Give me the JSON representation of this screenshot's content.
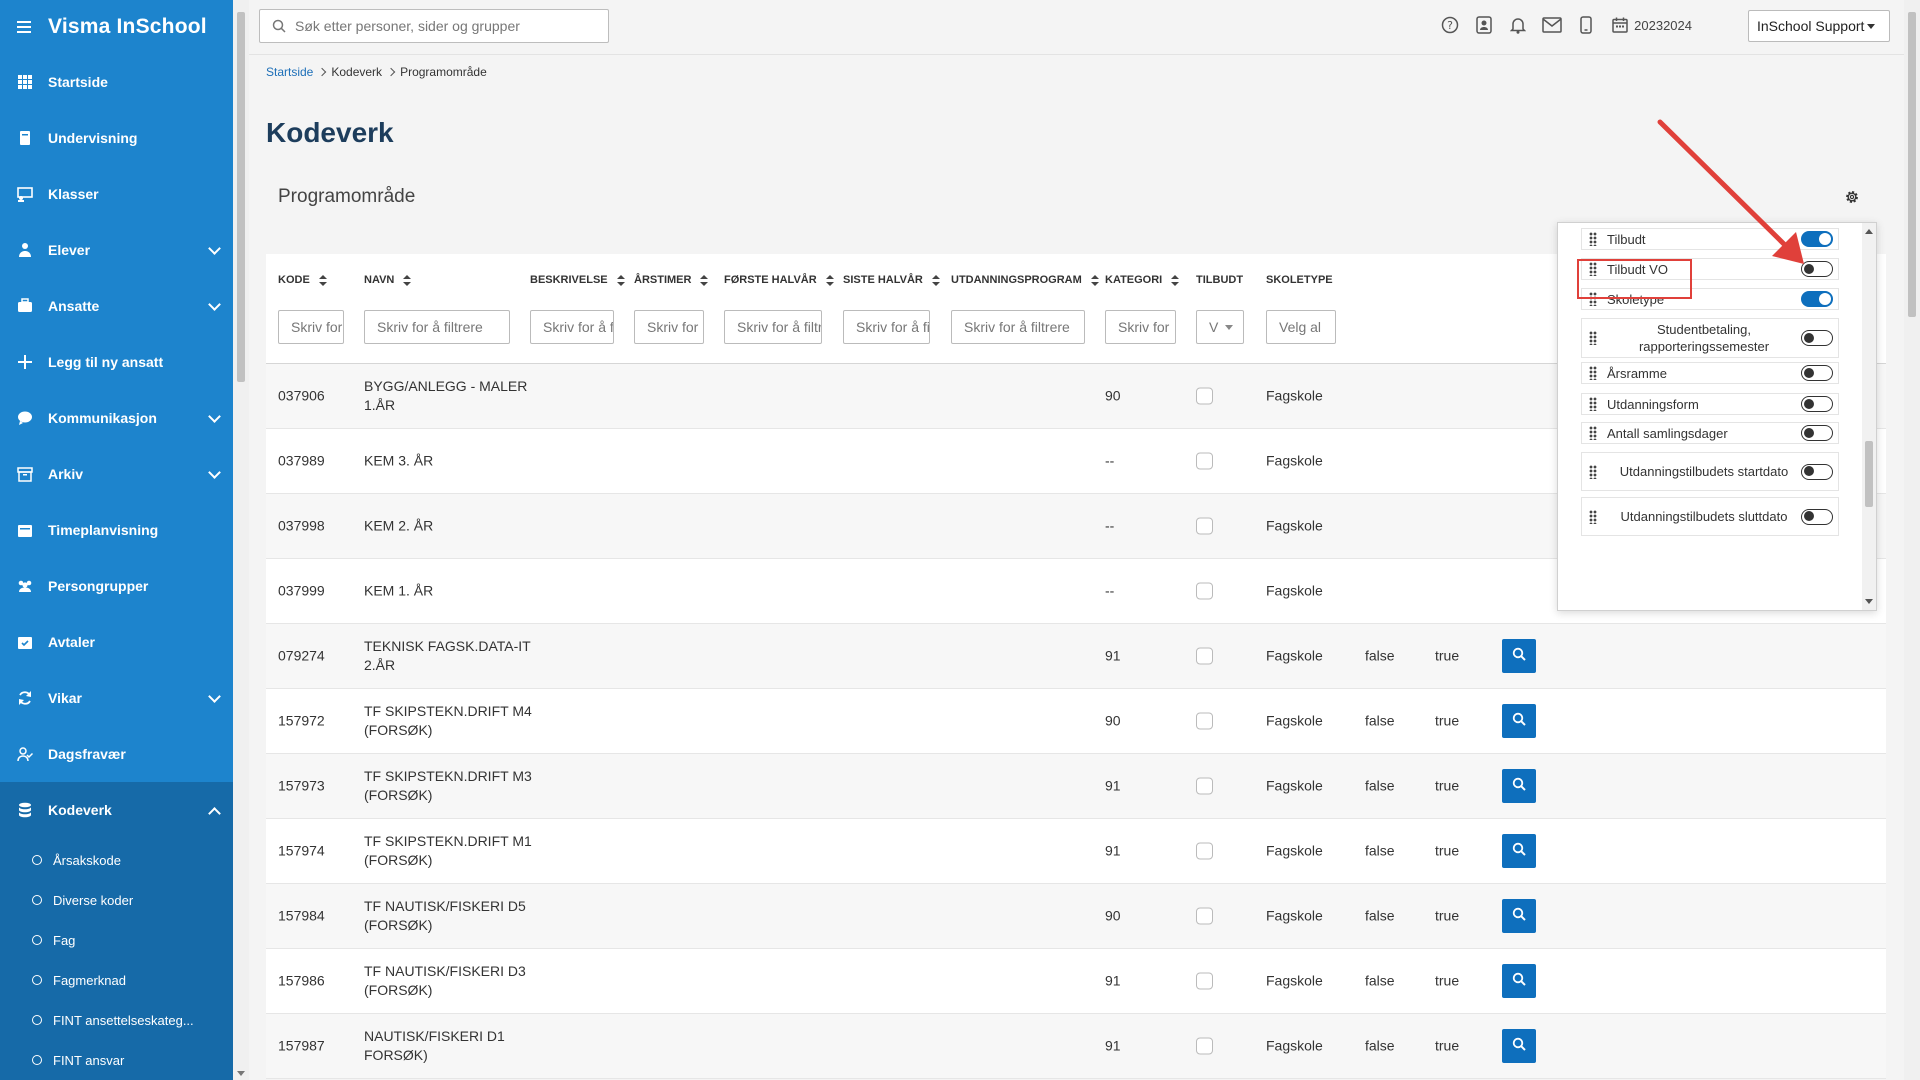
{
  "app": {
    "title": "Visma InSchool"
  },
  "sidebar": {
    "items": [
      {
        "label": "Startside",
        "icon": "grid-icon",
        "expandable": false
      },
      {
        "label": "Undervisning",
        "icon": "book-icon",
        "expandable": false
      },
      {
        "label": "Klasser",
        "icon": "classroom-icon",
        "expandable": false
      },
      {
        "label": "Elever",
        "icon": "student-icon",
        "expandable": true
      },
      {
        "label": "Ansatte",
        "icon": "briefcase-icon",
        "expandable": true
      },
      {
        "label": "Legg til ny ansatt",
        "icon": "plus-icon",
        "expandable": false
      },
      {
        "label": "Kommunikasjon",
        "icon": "chat-icon",
        "expandable": true
      },
      {
        "label": "Arkiv",
        "icon": "archive-icon",
        "expandable": true
      },
      {
        "label": "Timeplanvisning",
        "icon": "calendar-icon",
        "expandable": false
      },
      {
        "label": "Persongrupper",
        "icon": "group-icon",
        "expandable": false
      },
      {
        "label": "Avtaler",
        "icon": "calendar-check-icon",
        "expandable": false
      },
      {
        "label": "Vikar",
        "icon": "swap-icon",
        "expandable": true
      },
      {
        "label": "Dagsfravær",
        "icon": "user-absence-icon",
        "expandable": false
      },
      {
        "label": "Kodeverk",
        "icon": "database-icon",
        "expandable": true,
        "active": true
      }
    ],
    "subitems": [
      "Årsakskode",
      "Diverse koder",
      "Fag",
      "Fagmerknad",
      "FINT ansettelseskateg...",
      "FINT ansvar"
    ]
  },
  "topbar": {
    "search_placeholder": "Søk etter personer, sider og grupper",
    "year": "20232024",
    "user": "InSchool Support"
  },
  "breadcrumb": [
    "Startside",
    "Kodeverk",
    "Programområde"
  ],
  "page": {
    "title": "Kodeverk",
    "panel_title": "Programområde"
  },
  "table": {
    "columns": [
      "KODE",
      "NAVN",
      "BESKRIVELSE",
      "ÅRSTIMER",
      "FØRSTE HALVÅR",
      "SISTE HALVÅR",
      "UTDANNINGSPROGRAM",
      "KATEGORI",
      "TILBUDT",
      "SKOLETYPE"
    ],
    "filters": [
      "Skriv for",
      "Skriv for å filtrere",
      "Skriv for å f",
      "Skriv for",
      "Skriv for å filtr",
      "Skriv for å fi",
      "Skriv for å filtrere",
      "Skriv for",
      "V",
      "Velg al"
    ],
    "rows": [
      {
        "kode": "037906",
        "navn1": "BYGG/ANLEGG - MALER",
        "navn2": "1.ÅR",
        "kategori": "90",
        "skoletype": "Fagskole",
        "v1": "",
        "v2": "",
        "button": false
      },
      {
        "kode": "037989",
        "navn1": "KEM 3. ÅR",
        "navn2": "",
        "kategori": "--",
        "skoletype": "Fagskole",
        "v1": "",
        "v2": "",
        "button": false
      },
      {
        "kode": "037998",
        "navn1": "KEM 2. ÅR",
        "navn2": "",
        "kategori": "--",
        "skoletype": "Fagskole",
        "v1": "",
        "v2": "",
        "button": false
      },
      {
        "kode": "037999",
        "navn1": "KEM 1. ÅR",
        "navn2": "",
        "kategori": "--",
        "skoletype": "Fagskole",
        "v1": "",
        "v2": "",
        "button": false
      },
      {
        "kode": "079274",
        "navn1": "TEKNISK FAGSK.DATA-IT",
        "navn2": "2.ÅR",
        "kategori": "91",
        "skoletype": "Fagskole",
        "v1": "false",
        "v2": "true",
        "button": true
      },
      {
        "kode": "157972",
        "navn1": "TF SKIPSTEKN.DRIFT M4",
        "navn2": "(FORSØK)",
        "kategori": "90",
        "skoletype": "Fagskole",
        "v1": "false",
        "v2": "true",
        "button": true
      },
      {
        "kode": "157973",
        "navn1": "TF SKIPSTEKN.DRIFT M3",
        "navn2": "(FORSØK)",
        "kategori": "91",
        "skoletype": "Fagskole",
        "v1": "false",
        "v2": "true",
        "button": true
      },
      {
        "kode": "157974",
        "navn1": "TF SKIPSTEKN.DRIFT M1",
        "navn2": "(FORSØK)",
        "kategori": "91",
        "skoletype": "Fagskole",
        "v1": "false",
        "v2": "true",
        "button": true
      },
      {
        "kode": "157984",
        "navn1": "TF NAUTISK/FISKERI D5",
        "navn2": "(FORSØK)",
        "kategori": "90",
        "skoletype": "Fagskole",
        "v1": "false",
        "v2": "true",
        "button": true
      },
      {
        "kode": "157986",
        "navn1": "TF NAUTISK/FISKERI D3",
        "navn2": "(FORSØK)",
        "kategori": "91",
        "skoletype": "Fagskole",
        "v1": "false",
        "v2": "true",
        "button": true
      },
      {
        "kode": "157987",
        "navn1": "NAUTISK/FISKERI D1",
        "navn2": "FORSØK)",
        "kategori": "91",
        "skoletype": "Fagskole",
        "v1": "false",
        "v2": "true",
        "button": true
      }
    ]
  },
  "column_settings": {
    "items": [
      {
        "label": "Tilbudt",
        "on": true
      },
      {
        "label": "Tilbudt VO",
        "on": false,
        "highlighted": true
      },
      {
        "label": "Skoletype",
        "on": true
      },
      {
        "label": "Studentbetaling, rapporteringssemester",
        "on": false
      },
      {
        "label": "Årsramme",
        "on": false
      },
      {
        "label": "Utdanningsform",
        "on": false
      },
      {
        "label": "Antall samlingsdager",
        "on": false
      },
      {
        "label": "Utdanningstilbudets startdato",
        "on": false
      },
      {
        "label": "Utdanningstilbudets sluttdato",
        "on": false
      }
    ]
  },
  "colors": {
    "sidebar": "#1d84cd",
    "sidebar_active": "#166aa8",
    "accent": "#0e6fbd",
    "annotation": "#e0403a"
  }
}
